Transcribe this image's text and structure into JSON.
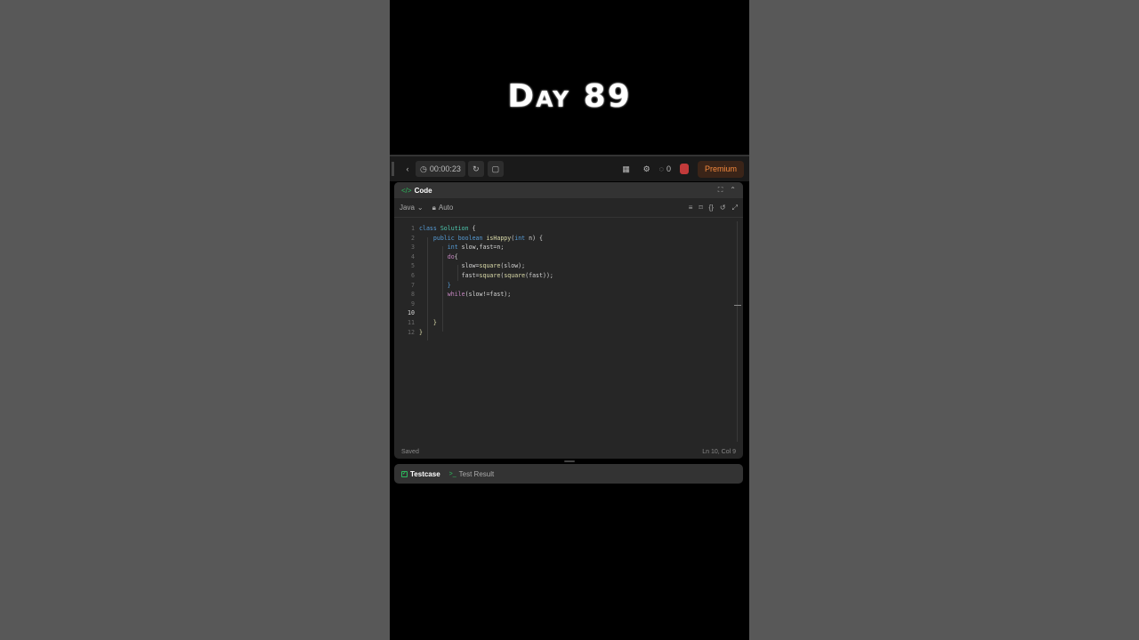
{
  "overlay": {
    "title": "Day 89"
  },
  "topbar": {
    "timer": "00:00:23",
    "streak": "0",
    "premium_label": "Premium"
  },
  "panel": {
    "title": "Code",
    "language": "Java",
    "autosave": "Auto"
  },
  "code": {
    "lines": [
      {
        "n": "1",
        "active": false
      },
      {
        "n": "2",
        "active": false
      },
      {
        "n": "3",
        "active": false
      },
      {
        "n": "4",
        "active": false
      },
      {
        "n": "5",
        "active": false
      },
      {
        "n": "6",
        "active": false
      },
      {
        "n": "7",
        "active": false
      },
      {
        "n": "8",
        "active": false
      },
      {
        "n": "9",
        "active": false
      },
      {
        "n": "10",
        "active": true
      },
      {
        "n": "11",
        "active": false
      },
      {
        "n": "12",
        "active": false
      }
    ],
    "tokens": {
      "l1": [
        "class ",
        "Solution",
        " {"
      ],
      "l2": [
        "public ",
        "boolean ",
        "isHappy",
        "(",
        "int",
        " n) {"
      ],
      "l3": [
        "int ",
        "slow,fast=n;"
      ],
      "l4": [
        "do",
        "{"
      ],
      "l5": [
        "slow=",
        "square",
        "(slow);"
      ],
      "l6": [
        "fast=",
        "square",
        "(",
        "square",
        "(fast));"
      ],
      "l7": [
        "}"
      ],
      "l8": [
        "while",
        "(slow!=fast);"
      ],
      "l11": [
        "}"
      ],
      "l12": [
        "}"
      ]
    }
  },
  "status": {
    "saved": "Saved",
    "position": "Ln 10, Col 9"
  },
  "bottom": {
    "testcase": "Testcase",
    "result": "Test Result"
  }
}
